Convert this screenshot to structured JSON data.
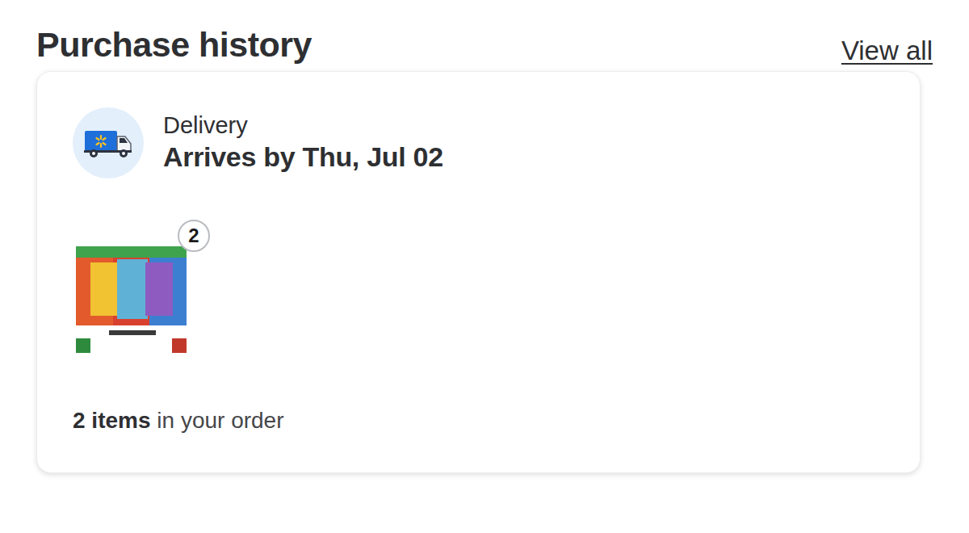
{
  "header": {
    "title": "Purchase history",
    "link": "View all"
  },
  "order": {
    "method": "Delivery",
    "arrival": "Arrives by Thu, Jul 02",
    "items": [
      {
        "quantity": "2"
      }
    ],
    "summary": {
      "count": "2 items",
      "text": "in your order"
    }
  }
}
